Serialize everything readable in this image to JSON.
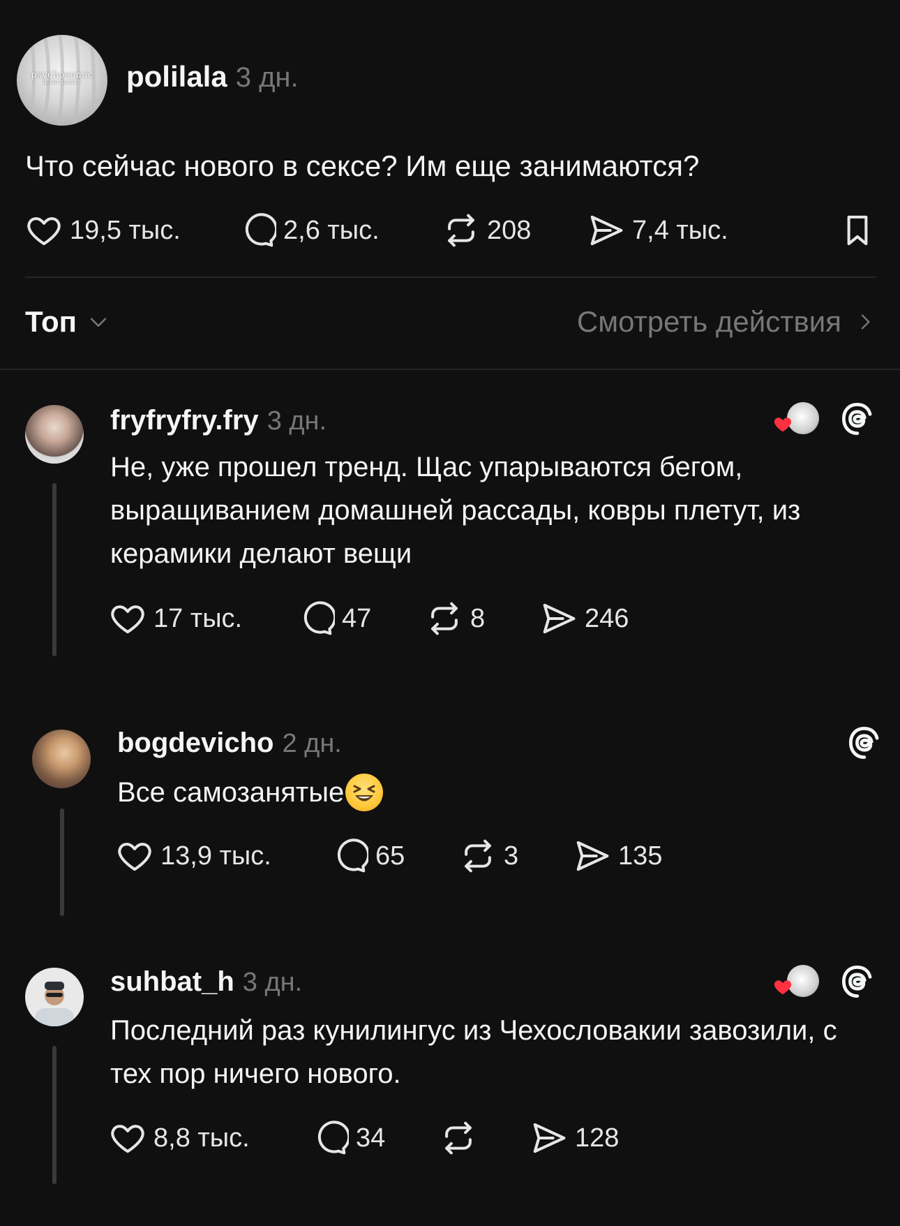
{
  "post": {
    "username": "polilala",
    "time": "3 дн.",
    "avatar_text": "psychosomic",
    "avatar_subtext": "alternative",
    "text": "Что сейчас нового в сексе? Им еще занимаются?",
    "likes": "19,5 тыс.",
    "comments": "2,6 тыс.",
    "reposts": "208",
    "shares": "7,4 тыс."
  },
  "filter": {
    "sort_label": "Топ",
    "view_activity_label": "Смотреть действия"
  },
  "replies": [
    {
      "username": "fryfryfry.fry",
      "time": "3 дн.",
      "text": "Не, уже прошел тренд. Щас упарываются бегом, выращиванием домашней рассады, ковры плетут, из керамики делают вещи",
      "likes": "17 тыс.",
      "comments": "47",
      "reposts": "8",
      "shares": "246"
    },
    {
      "username": "bogdevicho",
      "time": "2 дн.",
      "text": "Все самозанятые",
      "emoji": "😆",
      "likes": "13,9 тыс.",
      "comments": "65",
      "reposts": "3",
      "shares": "135"
    },
    {
      "username": "suhbat_h",
      "time": "3 дн.",
      "text": "Последний раз кунилингус из Чехословакии завозили, с тех пор ничего нового.",
      "likes": "8,8 тыс.",
      "comments": "34",
      "reposts": "",
      "shares": "128"
    }
  ],
  "colors": {
    "background": "#101010",
    "text": "#f3f5f7",
    "muted": "#777777",
    "like_red": "#ff3040"
  }
}
